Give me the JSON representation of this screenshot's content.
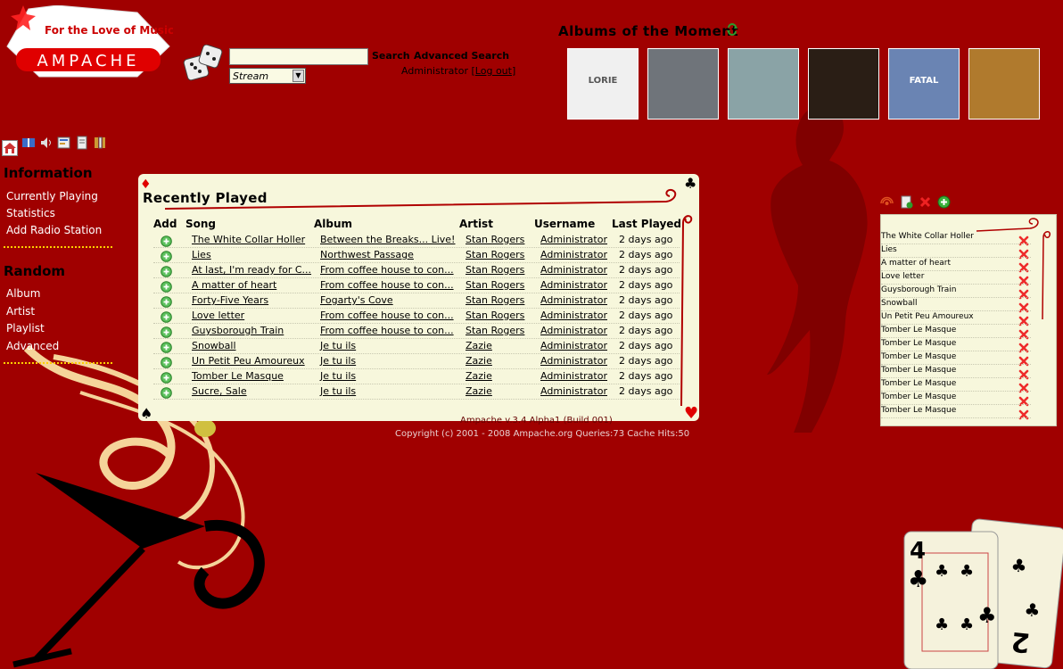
{
  "header": {
    "tagline": "For the Love of Music",
    "brand": "AMPACHE",
    "search_value": "",
    "search_label": "Search",
    "advanced_search_label": "Advanced Search",
    "search_type": "Stream",
    "user": "Administrator",
    "logout_label": "Log out"
  },
  "aotm": {
    "title": "Albums of the Moment",
    "covers": [
      {
        "name": "album-cover-1",
        "text": "LORIE",
        "bg": "#f0f0f0"
      },
      {
        "name": "album-cover-2",
        "text": "",
        "bg": "#6f747a"
      },
      {
        "name": "album-cover-3",
        "text": "",
        "bg": "#8aa3a6"
      },
      {
        "name": "album-cover-4",
        "text": "",
        "bg": "#2a1e15"
      },
      {
        "name": "album-cover-5",
        "text": "FATAL",
        "bg": "#6a84b3"
      },
      {
        "name": "album-cover-6",
        "text": "",
        "bg": "#b07a2d"
      }
    ]
  },
  "sidebar": {
    "information_title": "Information",
    "information_items": [
      "Currently Playing",
      "Statistics",
      "Add Radio Station"
    ],
    "random_title": "Random",
    "random_items": [
      "Album",
      "Artist",
      "Playlist",
      "Advanced"
    ]
  },
  "recent": {
    "title": "Recently Played",
    "columns": [
      "Add",
      "Song",
      "Album",
      "Artist",
      "Username",
      "Last Played"
    ],
    "rows": [
      [
        "The White Collar Holler",
        "Between the Breaks... Live!",
        "Stan Rogers",
        "Administrator",
        "2 days ago"
      ],
      [
        "Lies",
        "Northwest Passage",
        "Stan Rogers",
        "Administrator",
        "2 days ago"
      ],
      [
        "At last, I'm ready for C...",
        "From coffee house to con...",
        "Stan Rogers",
        "Administrator",
        "2 days ago"
      ],
      [
        "A matter of heart",
        "From coffee house to con...",
        "Stan Rogers",
        "Administrator",
        "2 days ago"
      ],
      [
        "Forty-Five Years",
        "Fogarty's Cove",
        "Stan Rogers",
        "Administrator",
        "2 days ago"
      ],
      [
        "Love letter",
        "From coffee house to con...",
        "Stan Rogers",
        "Administrator",
        "2 days ago"
      ],
      [
        "Guysborough Train",
        "From coffee house to con...",
        "Stan Rogers",
        "Administrator",
        "2 days ago"
      ],
      [
        "Snowball",
        "Je tu ils",
        "Zazie",
        "Administrator",
        "2 days ago"
      ],
      [
        "Un Petit Peu Amoureux",
        "Je tu ils",
        "Zazie",
        "Administrator",
        "2 days ago"
      ],
      [
        "Tomber Le Masque",
        "Je tu ils",
        "Zazie",
        "Administrator",
        "2 days ago"
      ],
      [
        "Sucre, Sale",
        "Je tu ils",
        "Zazie",
        "Administrator",
        "2 days ago"
      ]
    ]
  },
  "footer": {
    "version": "Ampache v.3.4 Alpha1 (Build 001)",
    "copyright": "Copyright (c) 2001 - 2008 Ampache.org Queries:73 Cache Hits:50"
  },
  "playlist": {
    "items": [
      "The White Collar Holler",
      "Lies",
      "A matter of heart",
      "Love letter",
      "Guysborough Train",
      "Snowball",
      "Un Petit Peu Amoureux",
      "Tomber Le Masque",
      "Tomber Le Masque",
      "Tomber Le Masque",
      "Tomber Le Masque",
      "Tomber Le Masque",
      "Tomber Le Masque",
      "Tomber Le Masque"
    ]
  },
  "cards": {
    "front_rank": "4",
    "back_rank": "2"
  },
  "colors": {
    "background": "#a00000",
    "panel": "#f7f7dc",
    "accent_red": "#d00000",
    "link_underline": "#000000"
  }
}
